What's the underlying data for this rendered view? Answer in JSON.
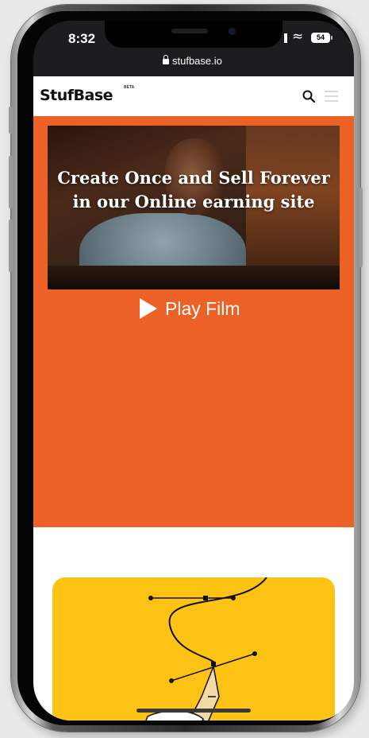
{
  "status_bar": {
    "time": "8:32",
    "battery": "54"
  },
  "browser": {
    "url": "stufbase.io"
  },
  "header": {
    "logo": "StufBase",
    "logo_badge": "BETA",
    "search_icon": "search-icon",
    "menu_icon": "hamburger-menu-icon"
  },
  "hero": {
    "background_color": "#ec6125",
    "title": "Create Once and Sell Forever in our Online earning site",
    "play_button_label": "Play Film"
  },
  "feature_card": {
    "background_color": "#fcc315",
    "illustration": "pen-tool-bezier-icon"
  }
}
